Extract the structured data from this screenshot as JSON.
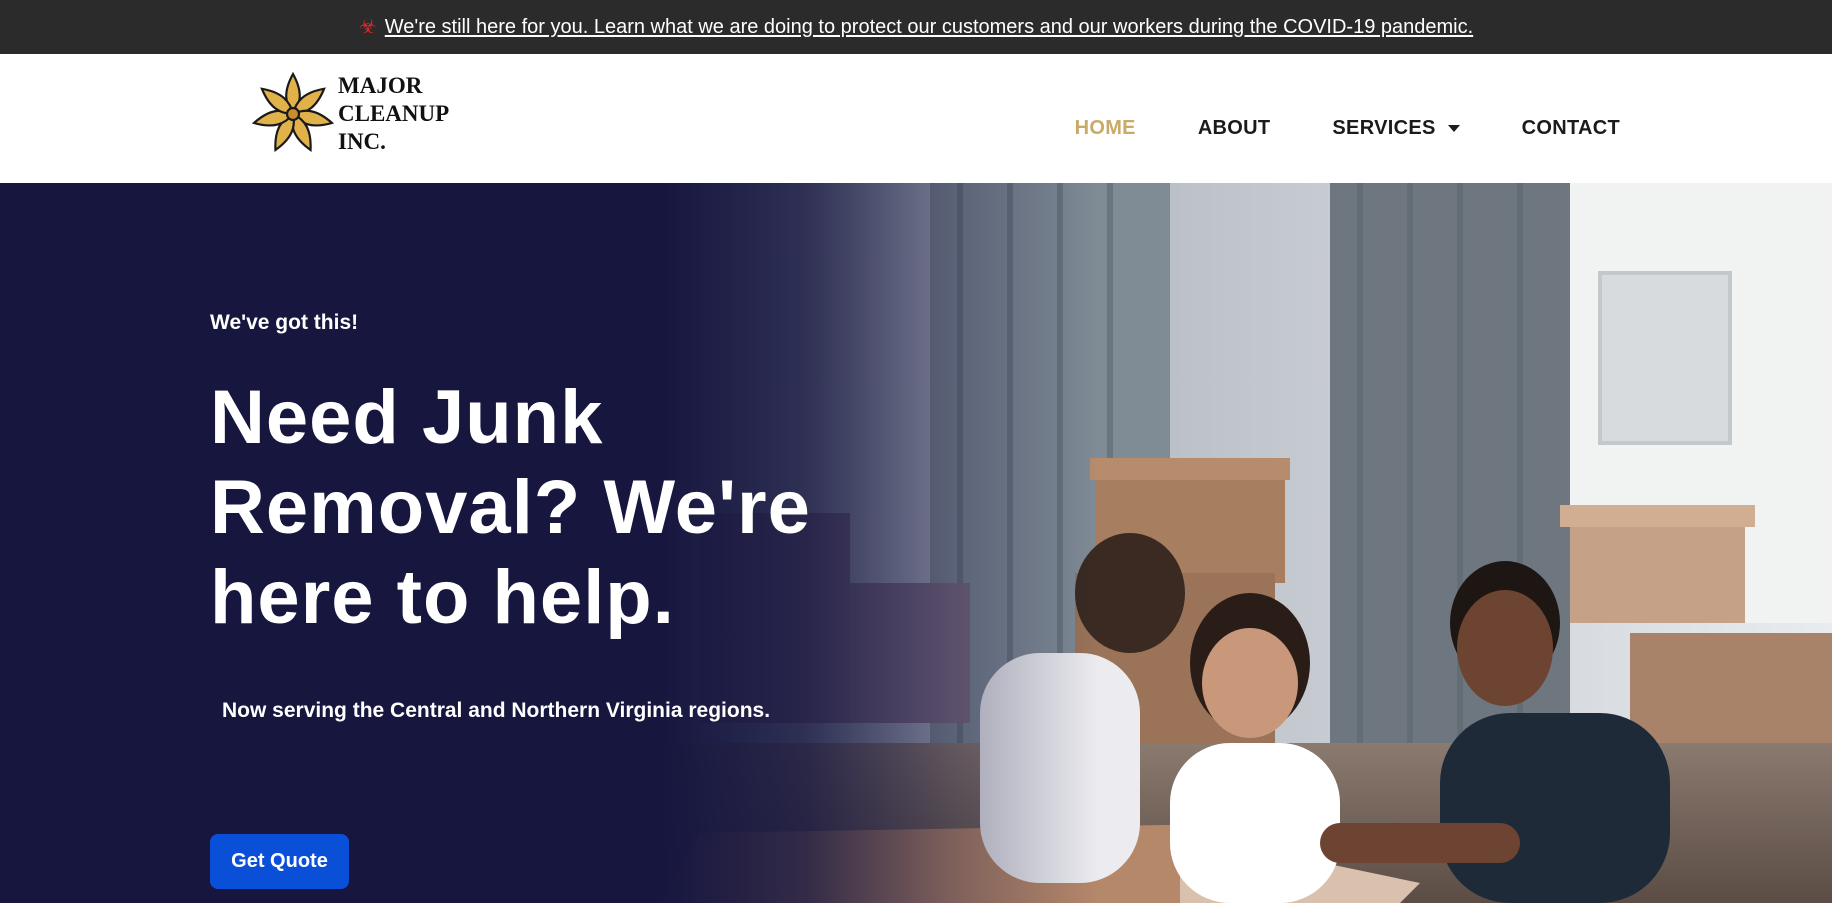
{
  "announcement": {
    "icon": "biohazard-icon",
    "text": "We're still here for you. Learn what we are doing to protect our customers and our workers during the COVID-19 pandemic.",
    "icon_color": "#e0262b"
  },
  "brand": {
    "logo_icon": "gold-leaf-icon",
    "line1": "MAJOR",
    "line2": "CLEANUP",
    "line3": "INC."
  },
  "nav": {
    "items": [
      {
        "label": "HOME",
        "active": true
      },
      {
        "label": "ABOUT",
        "active": false
      },
      {
        "label": "SERVICES",
        "active": false,
        "has_dropdown": true
      },
      {
        "label": "CONTACT",
        "active": false
      }
    ],
    "active_color": "#c9ab67"
  },
  "hero": {
    "eyebrow": "We've got this!",
    "headline": "Need Junk Removal? We're here to help.",
    "subline": "Now serving the Central and Northern Virginia regions.",
    "cta_label": "Get Quote",
    "background_color": "#16163f",
    "cta_color": "#0a4fd8"
  }
}
